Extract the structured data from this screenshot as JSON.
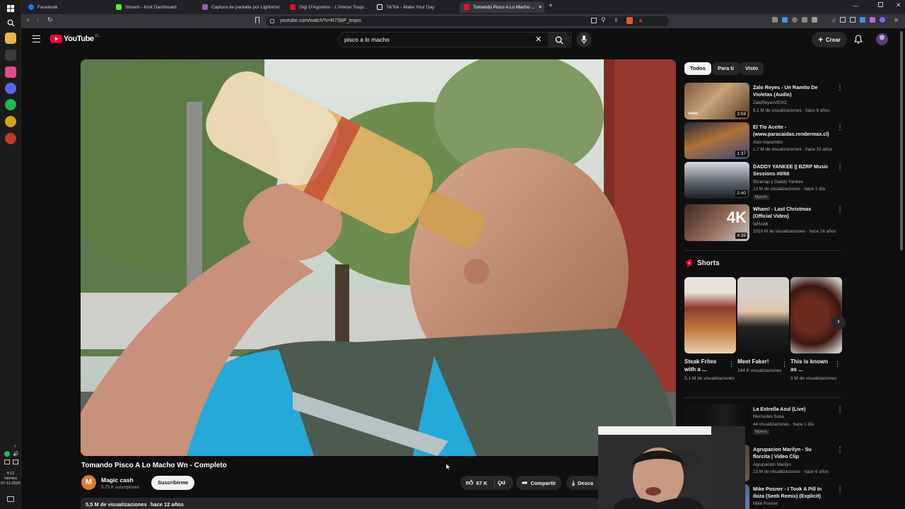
{
  "tabs": [
    {
      "label": "Facebook",
      "color": "#1877f2"
    },
    {
      "label": "Stream - Kick Dashboard",
      "color": "#53fc18"
    },
    {
      "label": "Captura de pantalla por Lightshot",
      "color": "#9b59b6"
    },
    {
      "label": "Gigi D'Agostino - L'Amour Toujo...",
      "color": "#ff0033"
    },
    {
      "label": "TikTok - Make Your Day",
      "color": "#ffffff"
    },
    {
      "label": "Tomando Pisco A Lo Macho ...",
      "color": "#ff0033"
    }
  ],
  "url": "youtube.com/watch?v=R7SbP_tnqxs",
  "taskbar": {
    "time": "4:12",
    "day": "viernes",
    "date": "07-11-2025"
  },
  "header": {
    "logo_text": "YouTube",
    "region": "CL",
    "search_query": "pisco a lo macho",
    "create_label": "Crear"
  },
  "chips": [
    "Todos",
    "Para ti",
    "Visto"
  ],
  "recommendations": [
    {
      "title": "Zalo Reyes - Un Ramito De Violetas (Audio)",
      "channel": "ZaloReyesVEVO",
      "meta": "9,1 M de visualizaciones · hace 6 años",
      "duration": "3:59",
      "badge": ""
    },
    {
      "title": "El Tío Aceite - (www.paracaidas.rendermax.cl)",
      "channel": "Alex marambio",
      "meta": "1,7 M de visualizaciones · hace 15 años",
      "duration": "1:37",
      "badge": ""
    },
    {
      "title": "DADDY YANKEE || BZRP Music Sessions #0/66",
      "channel": "Bizarrap y Daddy Yankee",
      "meta": "13 M de visualizaciones · hace 1 día",
      "duration": "2:40",
      "badge": "Nuevo"
    },
    {
      "title": "Wham! - Last Christmas (Official Video)",
      "channel": "WHAM!",
      "meta": "1019 M de visualizaciones · hace 16 años",
      "duration": "4:39",
      "badge": ""
    }
  ],
  "shorts": {
    "heading": "Shorts",
    "items": [
      {
        "title": "Steak Frites with a ...",
        "views": "5,1 M de visualizaciones"
      },
      {
        "title": "Meet Faker!",
        "views": "344 K visualizaciones"
      },
      {
        "title": "This is known as ...",
        "views": "3 M de visualizaciones"
      }
    ]
  },
  "recommendations2": [
    {
      "title": "La Estrella Azul (Live)",
      "channel": "Mercedes Sosa",
      "meta": "44 visualizaciones · hace 1 día",
      "badge": "Nuevo"
    },
    {
      "title": "Agrupacion Marilyn - Su florcita | Video Clip",
      "channel": "Agrupacion Marilyn",
      "meta": "23 M de visualizaciones · hace 6 años",
      "badge": ""
    },
    {
      "title": "Mike Posner - I Took A Pill In Ibiza (Seeb Remix) (Explicit)",
      "channel": "Mike Posner",
      "meta": "",
      "badge": ""
    }
  ],
  "video": {
    "title": "Tomando Pisco A Lo Macho Wn - Completo",
    "channel": "Magic cash",
    "channel_initial": "M",
    "subscribers": "5,75 K suscriptores",
    "subscribe_label": "Suscribirme",
    "likes": "67 K",
    "share_label": "Compartir",
    "download_label": "Desca",
    "views": "5,5 M de visualizaciones",
    "age": "hace 12 años"
  }
}
